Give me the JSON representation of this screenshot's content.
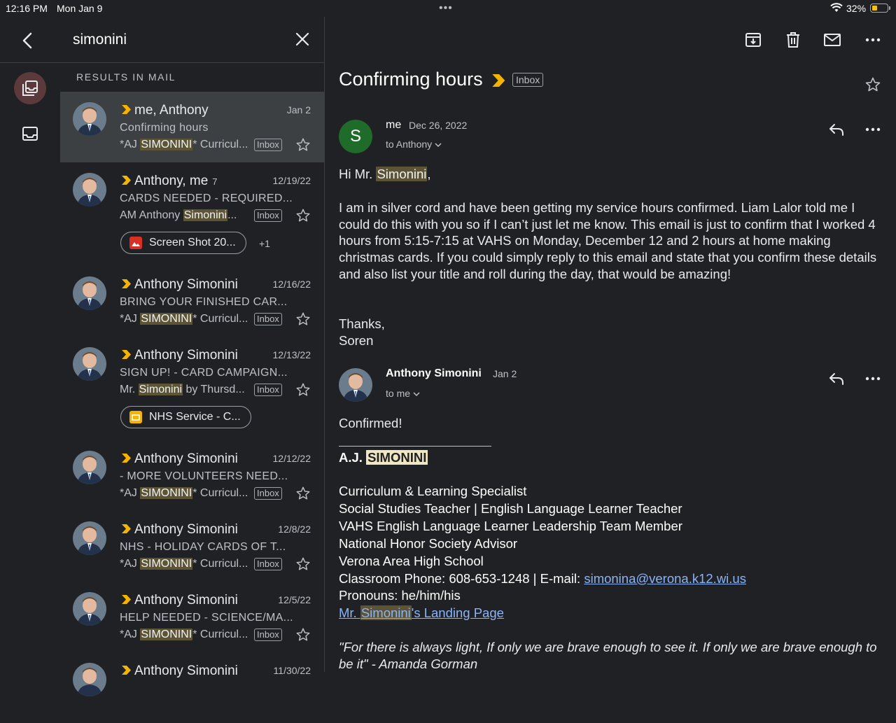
{
  "status_bar": {
    "time": "12:16 PM",
    "date": "Mon Jan 9",
    "battery": "32%",
    "battery_level": 0.32
  },
  "search": {
    "query": "simonini",
    "results_label": "RESULTS IN MAIL"
  },
  "colors": {
    "accent": "#f4b400",
    "highlight": "#5c5434",
    "link": "#8ab4f8",
    "avatar_s": "#1e6b2a"
  },
  "results": [
    {
      "sender": "me, Anthony",
      "count": "",
      "date": "Jan 2",
      "subject": "Confirming hours",
      "snippet_pre": "*AJ ",
      "snippet_hl": "SIMONINI",
      "snippet_post": "* Curricul...",
      "tag": "Inbox"
    },
    {
      "sender": "Anthony, me",
      "count": "7",
      "date": "12/19/22",
      "subject": "CARDS NEEDED - REQUIRED...",
      "snippet_pre": "AM Anthony ",
      "snippet_hl": "Simonini",
      "snippet_post": "...",
      "tag": "Inbox",
      "chip": {
        "label": "Screen Shot 20...",
        "more": "+1",
        "icon": "image-icon"
      }
    },
    {
      "sender": "Anthony Simonini",
      "count": "",
      "date": "12/16/22",
      "subject": "BRING YOUR FINISHED CAR...",
      "snippet_pre": "*AJ ",
      "snippet_hl": "SIMONINI",
      "snippet_post": "* Curricul...",
      "tag": "Inbox"
    },
    {
      "sender": "Anthony Simonini",
      "count": "",
      "date": "12/13/22",
      "subject": "SIGN UP! - CARD CAMPAIGN...",
      "snippet_pre": "Mr. ",
      "snippet_hl": "Simonini",
      "snippet_post": " by Thursd...",
      "tag": "Inbox",
      "chip": {
        "label": "NHS Service - C...",
        "icon": "slides-icon"
      }
    },
    {
      "sender": "Anthony Simonini",
      "count": "",
      "date": "12/12/22",
      "subject": "- MORE VOLUNTEERS NEED...",
      "snippet_pre": "*AJ ",
      "snippet_hl": "SIMONINI",
      "snippet_post": "* Curricul...",
      "tag": "Inbox"
    },
    {
      "sender": "Anthony Simonini",
      "count": "",
      "date": "12/8/22",
      "subject": "NHS - HOLIDAY CARDS OF T...",
      "snippet_pre": "*AJ ",
      "snippet_hl": "SIMONINI",
      "snippet_post": "* Curricul...",
      "tag": "Inbox"
    },
    {
      "sender": "Anthony Simonini",
      "count": "",
      "date": "12/5/22",
      "subject": "HELP NEEDED - SCIENCE/MA...",
      "snippet_pre": "*AJ ",
      "snippet_hl": "SIMONINI",
      "snippet_post": "* Curricul...",
      "tag": "Inbox"
    },
    {
      "sender": "Anthony Simonini",
      "count": "",
      "date": "11/30/22"
    }
  ],
  "thread": {
    "subject": "Confirming hours",
    "tag": "Inbox",
    "message1": {
      "avatar_letter": "S",
      "from": "me",
      "date": "Dec 26, 2022",
      "to": "to Anthony",
      "greeting_pre": "Hi Mr. ",
      "greeting_hl": "Simonini",
      "greeting_post": ",",
      "body": "I am in silver cord and have been getting my service hours confirmed. Liam Lalor told me I could do this with you so if I can’t just let me know. This email is just to confirm that I worked 4 hours from 5:15-7:15 at VAHS on Monday, December 12 and 2 hours at home making christmas cards. If you could simply reply to this email and state that you confirm these details and also list your title and roll during the day, that would be amazing!",
      "closing": "Thanks,",
      "signoff": "Soren"
    },
    "message2": {
      "from": "Anthony Simonini",
      "date": "Jan 2",
      "to": "to me",
      "body": "Confirmed!",
      "sig_name_pre": "A.J. ",
      "sig_name_hl": "SIMONINI",
      "sig_lines": [
        "Curriculum & Learning Specialist",
        "Social Studies Teacher | English Language Learner Teacher",
        "VAHS English Language Learner Leadership Team Member",
        "National Honor Society Advisor",
        "Verona Area High School"
      ],
      "phone_label": "Classroom Phone: 608-653-1248 | E-mail: ",
      "email": "simonina@verona.k12.wi.us",
      "pronouns": "Pronouns: he/him/his",
      "landing_pre": "Mr. ",
      "landing_hl": "Simonini",
      "landing_post": "'s Landing Page ",
      "quote": "\"For there is always light, If only we are brave enough to see it. If only we are brave enough to be it\" - Amanda Gorman"
    }
  }
}
